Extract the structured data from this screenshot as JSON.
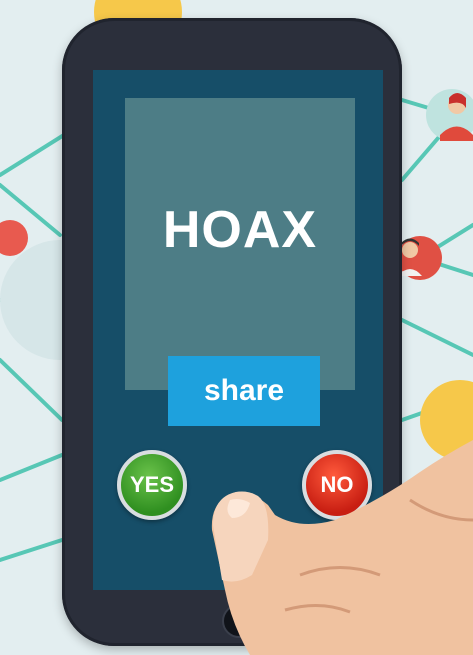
{
  "screen": {
    "headline": "HOAX",
    "share_label": "share",
    "yes_label": "YES",
    "no_label": "NO"
  },
  "colors": {
    "background": "#e3eef0",
    "phone_body": "#2b2f3b",
    "screen": "#164e68",
    "card": "#4d7d86",
    "share": "#1ea1dd",
    "yes": "#3aa52a",
    "no": "#e0321e",
    "network_line": "#57c7b5"
  },
  "icons": [
    "person-avatar-icon",
    "network-line-icon",
    "hand-icon"
  ]
}
